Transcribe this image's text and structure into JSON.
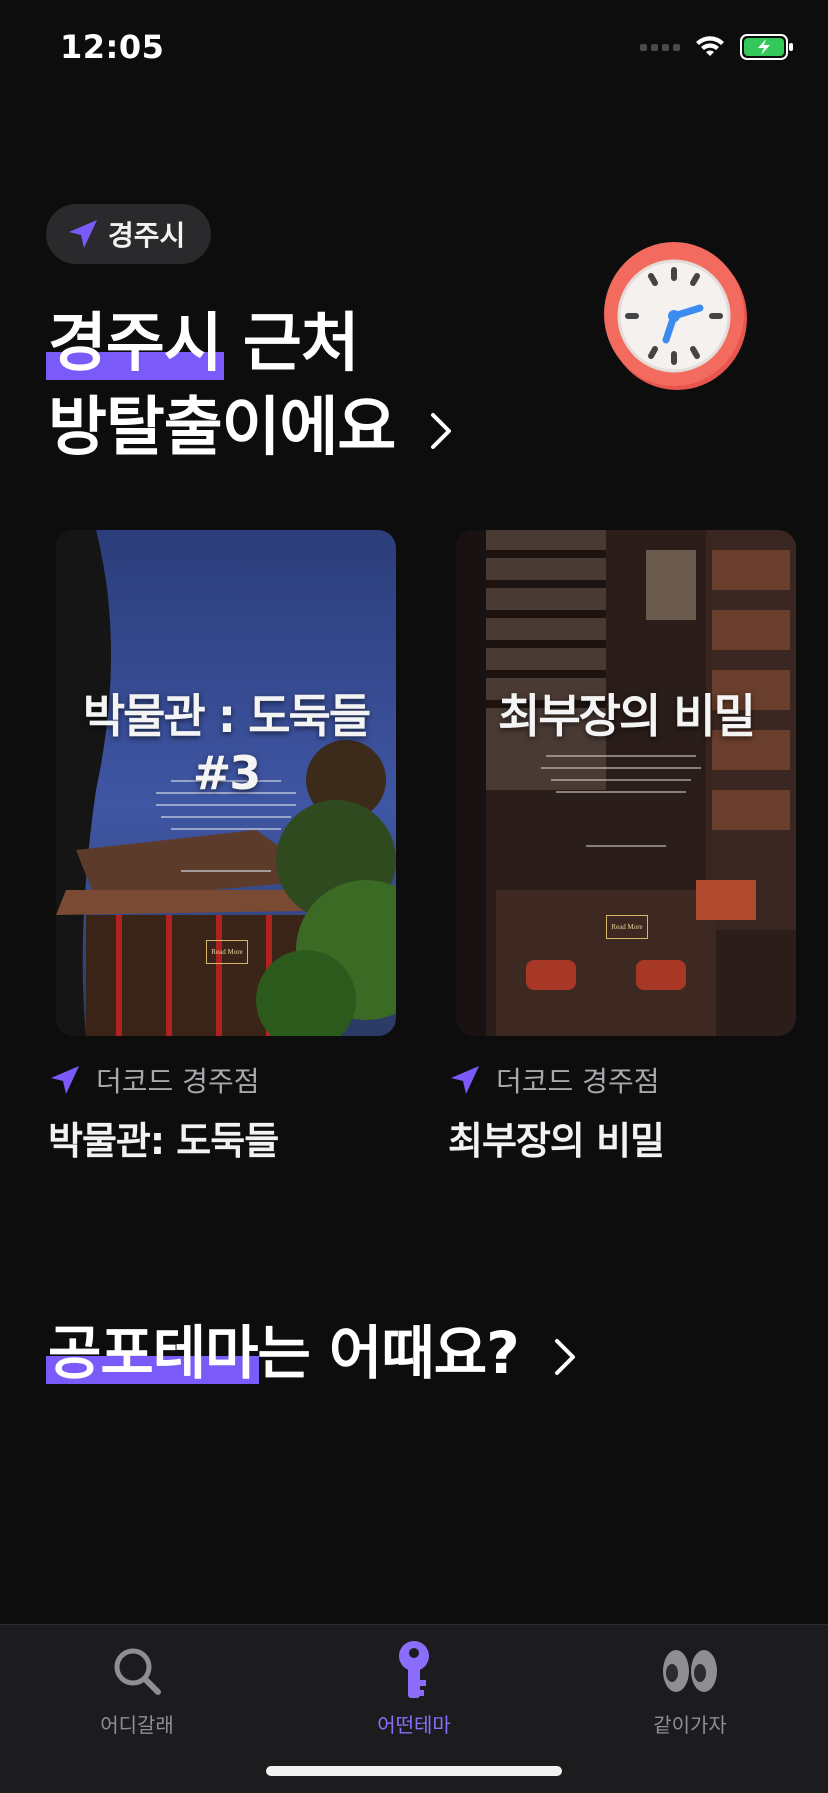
{
  "status": {
    "time": "12:05"
  },
  "location_chip": {
    "label": "경주시",
    "icon": "location-arrow-icon"
  },
  "headline": {
    "highlight": "경주시",
    "rest_line1": " 근처",
    "line2": "방탈출이에요"
  },
  "themes": [
    {
      "store": "더코드 경주점",
      "title": "박물관: 도둑들",
      "poster_title": "박물관 : 도둑들 #3"
    },
    {
      "store": "더코드 경주점",
      "title": "최부장의 비밀",
      "poster_title": "최부장의 비밀"
    }
  ],
  "section2": {
    "highlight": "공포테마",
    "rest": "는 어때요?"
  },
  "tabbar": {
    "tabs": [
      {
        "label": "어디갈래",
        "icon": "search-icon"
      },
      {
        "label": "어떤테마",
        "icon": "key-icon",
        "active": true
      },
      {
        "label": "같이가자",
        "icon": "eyes-icon"
      }
    ]
  },
  "colors": {
    "accent": "#7a5af8",
    "background": "#0d0d0e",
    "tabbar": "#1c1c1e"
  }
}
